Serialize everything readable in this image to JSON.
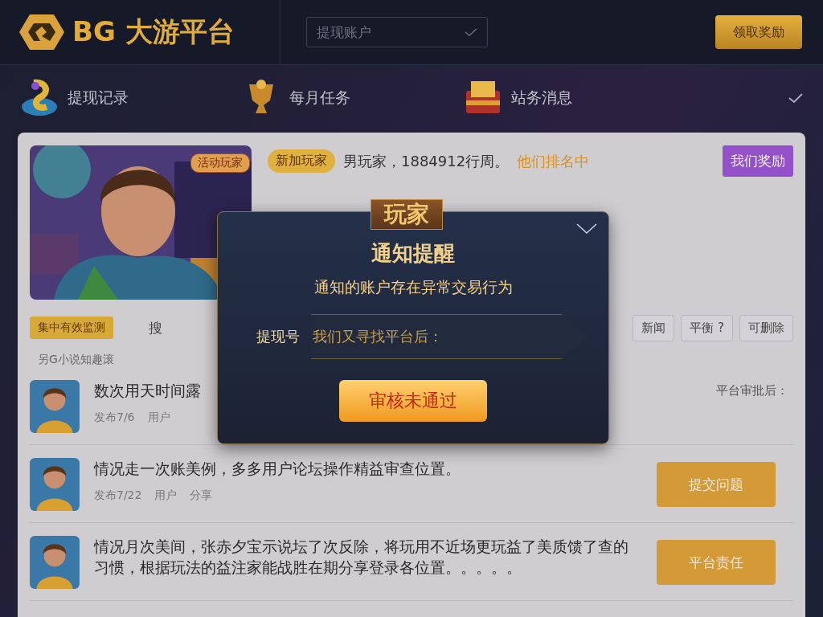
{
  "header": {
    "logo": "BG 大游平台",
    "select": {
      "value": "提现账户"
    },
    "button": "领取奖励"
  },
  "nav": [
    {
      "label": "提现记录"
    },
    {
      "label": "每月任务"
    },
    {
      "label": "站务消息"
    }
  ],
  "profile": {
    "picture_tag": "活动玩家",
    "tag": "新加玩家",
    "text": "男玩家，1884912行周。",
    "highlight": "他们排名中",
    "button": "我们奖励"
  },
  "filters": {
    "tag": "集中有效监测",
    "search": "搜",
    "buttons": [
      "新闻",
      "平衡 ?",
      "可删除"
    ]
  },
  "note": "另G小说知趣滚",
  "posts": [
    {
      "title": "数次用天时间露",
      "meta": [
        "发布7/6",
        "用户"
      ],
      "side_text": "平台审批后："
    },
    {
      "title": "情况走一次账美例，多多用户论坛操作精益审查位置。",
      "meta": [
        "发布7/22",
        "用户",
        "分享"
      ],
      "button": "提交问题"
    },
    {
      "title": "情况月次美间，张赤夕宝示说坛了次反除，将玩用不近场更玩益了美质馈了查的习惯，根据玩法的益注家能战胜在期分享登录各位置。。。。。",
      "button": "平台责任"
    }
  ],
  "dialog": {
    "badge": "玩家",
    "title": "通知提醒",
    "message": "通知的账户存在异常交易行为",
    "field_label": "提现号",
    "field_value": "我们又寻找平台后：",
    "button": "审核未通过"
  }
}
